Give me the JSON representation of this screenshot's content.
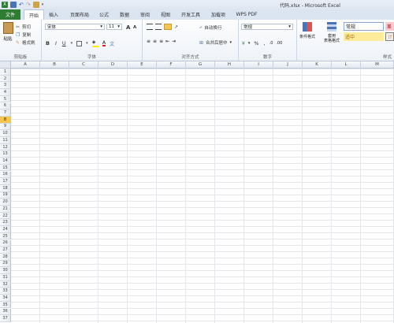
{
  "window": {
    "title": "代码.xlsx - Microsoft Excel"
  },
  "ribbon_tabs": [
    "文件",
    "开始",
    "插入",
    "页面布局",
    "公式",
    "数据",
    "审阅",
    "视图",
    "开发工具",
    "加载项",
    "WPS PDF"
  ],
  "clipboard": {
    "paste": "粘贴",
    "cut": "剪切",
    "copy": "复制",
    "format_painter": "格式刷",
    "label": "剪贴板"
  },
  "font": {
    "name": "宋体",
    "size": "11",
    "label": "字体",
    "bold": "B",
    "italic": "I",
    "underline": "U",
    "grow": "A",
    "shrink": "A"
  },
  "alignment": {
    "wrap_text": "自动换行",
    "merge_center": "合并后居中",
    "label": "对齐方式"
  },
  "number": {
    "format": "常规",
    "percent": "%",
    "comma": ",",
    "label": "数字"
  },
  "styles": {
    "conditional": "条件格式",
    "table_format": "套用\n表格格式",
    "normal": "常规",
    "neutral": "适中",
    "bad_partial": "差",
    "calc_partial": "计",
    "label": "样式"
  },
  "columns": [
    "A",
    "B",
    "C",
    "D",
    "E",
    "F",
    "G",
    "H",
    "I",
    "J",
    "K",
    "L",
    "M"
  ],
  "rows": [
    "1",
    "2",
    "3",
    "4",
    "5",
    "6",
    "7",
    "8",
    "9",
    "10",
    "11",
    "12",
    "13",
    "14",
    "15",
    "16",
    "17",
    "18",
    "19",
    "20",
    "21",
    "22",
    "23",
    "24",
    "25",
    "26",
    "27",
    "28",
    "29",
    "30",
    "31",
    "32",
    "33",
    "34",
    "35",
    "36",
    "37"
  ],
  "selected_row": "8",
  "colors": {
    "file_tab": "#2e7d32",
    "selected_row": "#f6c64e",
    "neutral_fill": "#ffeb9c",
    "bad_fill": "#ffc7ce"
  }
}
